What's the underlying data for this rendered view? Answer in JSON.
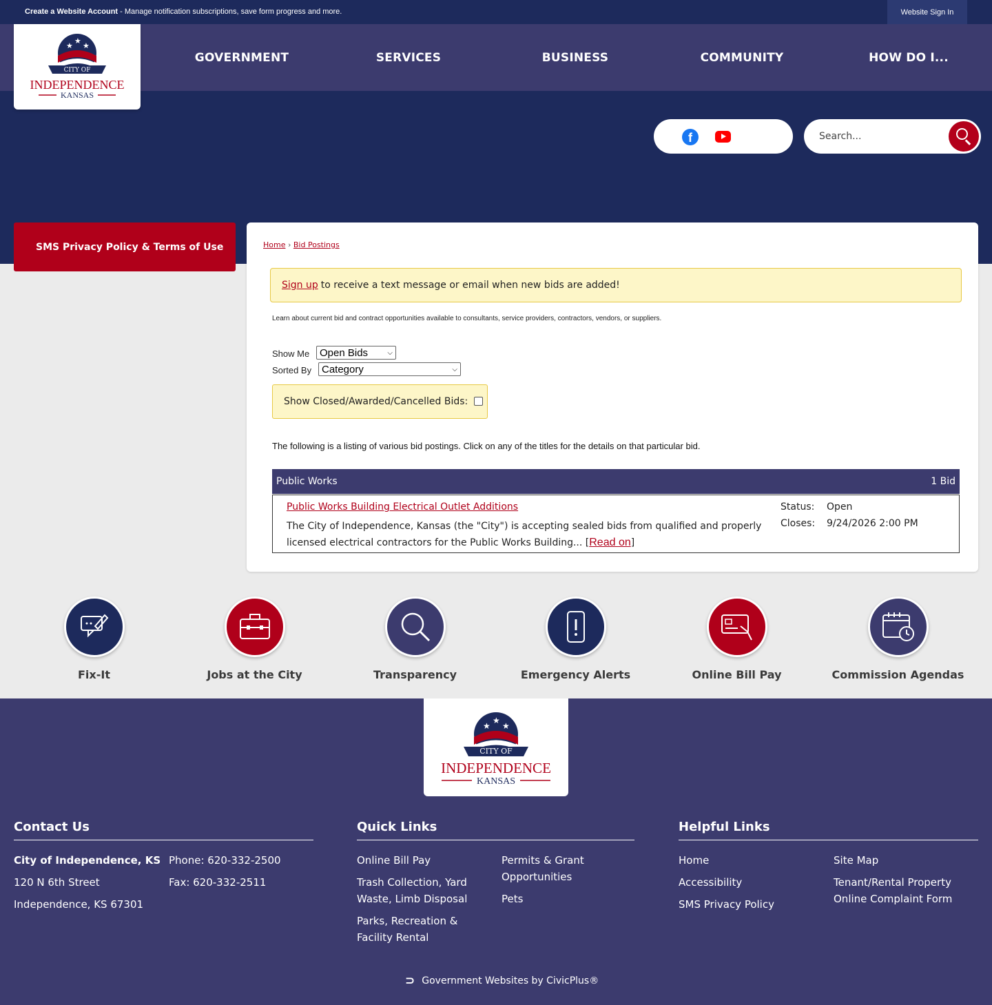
{
  "topbar": {
    "create_account": "Create a Website Account",
    "message": " - Manage notification subscriptions, save form progress and more.",
    "signin": "Website Sign In"
  },
  "logo": {
    "city_of": "CITY OF",
    "name": "INDEPENDENCE",
    "state": "KANSAS"
  },
  "nav": [
    "GOVERNMENT",
    "SERVICES",
    "BUSINESS",
    "COMMUNITY",
    "HOW DO I..."
  ],
  "search": {
    "placeholder": "Search..."
  },
  "social": [
    "facebook-icon",
    "youtube-icon"
  ],
  "sidebar": {
    "item": "SMS Privacy Policy & Terms of Use"
  },
  "breadcrumb": {
    "home": "Home",
    "sep": "›",
    "current": "Bid Postings"
  },
  "alert": {
    "link": "Sign up",
    "text": "to receive a text message or email when new bids are added!"
  },
  "intro": "Learn about current bid and contract opportunities available to consultants, service providers, contractors, vendors, or suppliers.",
  "filters": {
    "show_me_label": "Show Me",
    "show_me_value": "Open Bids",
    "sorted_by_label": "Sorted By",
    "sorted_by_value": "Category",
    "closed_label": "Show Closed/Awarded/Cancelled Bids:"
  },
  "listing_text": "The following is a listing of various bid postings. Click on any of the titles for the details on that particular bid.",
  "category": {
    "name": "Public Works",
    "count": "1 Bid"
  },
  "bid": {
    "title": "Public Works Building Electrical Outlet Additions",
    "desc": "The City of Independence, Kansas (the \"City\") is accepting sealed bids from qualified and properly licensed electrical contractors for the Public Works Building... ",
    "read_on": "Read on",
    "status_label": "Status:",
    "status_value": "Open",
    "closes_label": "Closes:",
    "closes_value": "9/24/2026 2:00 PM"
  },
  "quick_links": [
    {
      "label": "Fix-It",
      "icon": "fix-it-icon",
      "color": "#1d2a5c"
    },
    {
      "label": "Jobs at the City",
      "icon": "briefcase-icon",
      "color": "#b0001a"
    },
    {
      "label": "Transparency",
      "icon": "magnifier-icon",
      "color": "#3c3b6e"
    },
    {
      "label": "Emergency Alerts",
      "icon": "phone-alert-icon",
      "color": "#1d2a5c"
    },
    {
      "label": "Online Bill Pay",
      "icon": "credit-card-icon",
      "color": "#b0001a"
    },
    {
      "label": "Commission Agendas",
      "icon": "calendar-clock-icon",
      "color": "#3c3b6e"
    }
  ],
  "footer": {
    "contact": {
      "heading": "Contact Us",
      "name": "City of Independence, KS",
      "street": "120 N 6th Street",
      "city": "Independence, KS 67301",
      "phone": "Phone: 620-332-2500",
      "fax": "Fax: 620-332-2511"
    },
    "quick": {
      "heading": "Quick Links",
      "col1": [
        "Online Bill Pay",
        "Trash Collection, Yard Waste, Limb Disposal",
        "Parks, Recreation & Facility Rental"
      ],
      "col2": [
        "Permits & Grant Opportunities",
        "Pets"
      ]
    },
    "helpful": {
      "heading": "Helpful Links",
      "col1": [
        "Home",
        "Accessibility",
        "SMS Privacy Policy"
      ],
      "col2": [
        "Site Map",
        "Tenant/Rental Property Online Complaint Form"
      ]
    },
    "civicplus": "Government Websites by CivicPlus®"
  },
  "colors": {
    "navy": "#1d2a5c",
    "purple": "#3c3b6e",
    "red": "#b0001a",
    "alert_bg": "#fdf6c8"
  }
}
